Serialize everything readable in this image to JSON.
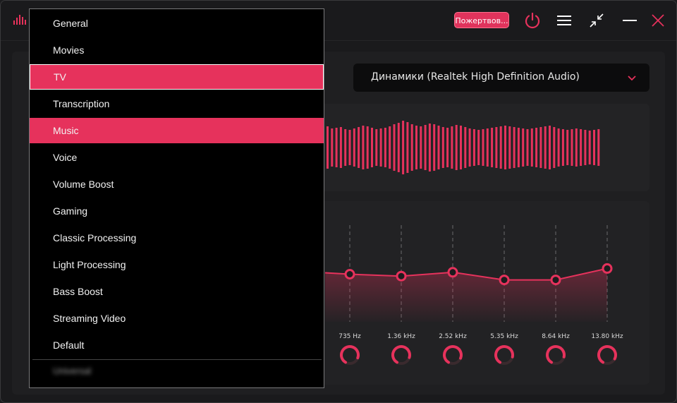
{
  "titlebar": {
    "donate_label": "Пожертвов...",
    "icons": [
      "power-icon",
      "menu-icon",
      "collapse-icon",
      "minimize-icon",
      "close-icon"
    ]
  },
  "device": {
    "label": "Динамики (Realtek High Definition Audio)",
    "icon": "chevron-down-icon"
  },
  "eq": {
    "bands": [
      {
        "freq": "735 Hz",
        "level": 0.5
      },
      {
        "freq": "1.36 kHz",
        "level": 0.48
      },
      {
        "freq": "2.52 kHz",
        "level": 0.52
      },
      {
        "freq": "5.35 kHz",
        "level": 0.44
      },
      {
        "freq": "8.64 kHz",
        "level": 0.44
      },
      {
        "freq": "13.80 kHz",
        "level": 0.56
      }
    ]
  },
  "menu": {
    "items": [
      {
        "label": "General"
      },
      {
        "label": "Movies"
      },
      {
        "label": "TV",
        "state": "selected"
      },
      {
        "label": "Transcription"
      },
      {
        "label": "Music",
        "state": "hover"
      },
      {
        "label": "Voice"
      },
      {
        "label": "Volume Boost"
      },
      {
        "label": "Gaming"
      },
      {
        "label": "Classic Processing"
      },
      {
        "label": "Light Processing"
      },
      {
        "label": "Bass Boost"
      },
      {
        "label": "Streaming Video"
      },
      {
        "label": "Default"
      }
    ],
    "blurred_item": "Universal"
  },
  "colors": {
    "accent": "#e6325c",
    "background": "#1a1a1c",
    "menu_bg": "#000000"
  }
}
